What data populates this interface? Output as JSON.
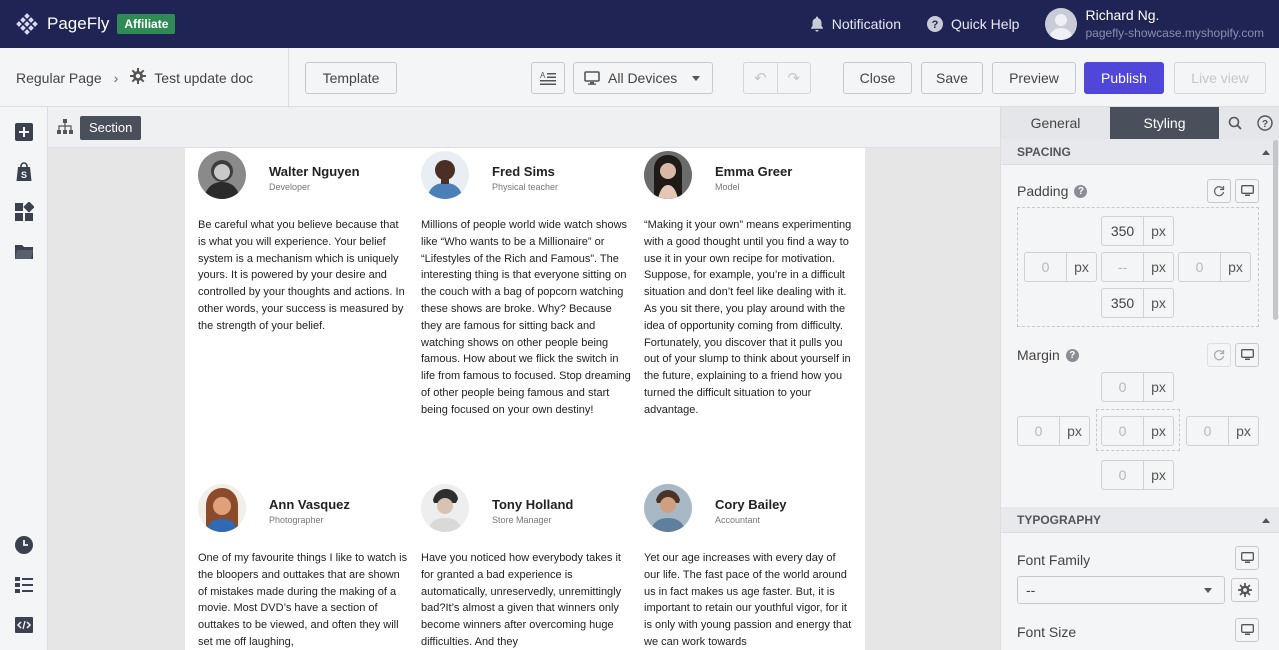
{
  "topbar": {
    "brand": "PageFly",
    "badge": "Affiliate",
    "notification": "Notification",
    "quick_help": "Quick Help",
    "user_name": "Richard Ng.",
    "user_shop": "pagefly-showcase.myshopify.com"
  },
  "toolbar": {
    "page_type": "Regular Page",
    "page_name": "Test update doc",
    "template": "Template",
    "devices": "All Devices",
    "close": "Close",
    "save": "Save",
    "preview": "Preview",
    "publish": "Publish",
    "live_view": "Live view"
  },
  "canvas": {
    "section_tag": "Section",
    "cards": [
      {
        "name": "Walter Nguyen",
        "role": "Developer",
        "quote": "Be careful what you believe because that is what you will experience. Your belief system is a mechanism which is uniquely yours. It is powered by your desire and controlled by your thoughts and actions. In other words, your success is measured by the strength of your belief."
      },
      {
        "name": "Fred Sims",
        "role": "Physical teacher",
        "quote": "Millions of people world wide watch shows like “Who wants to be a Millionaire” or “Lifestyles of the Rich and Famous”. The interesting thing is that everyone sitting on the couch with a bag of popcorn watching these shows are broke. Why? Because they are famous for sitting back and watching shows on other people being famous. How about we flick the switch in life from famous to focused. Stop dreaming of other people being famous and start being focused on your own destiny!"
      },
      {
        "name": "Emma Greer",
        "role": "Model",
        "quote": "“Making it your own” means experimenting with a good thought until you find a way to use it in your own recipe for motivation. Suppose, for example, you’re in a difficult situation and don’t feel like dealing with it. As you sit there, you play around with the idea of opportunity coming from difficulty. Fortunately, you discover that it pulls you out of your slump to think about yourself in the future, explaining to a friend how you turned the difficult situation to your advantage."
      },
      {
        "name": "Ann Vasquez",
        "role": "Photographer",
        "quote": "One of my favourite things I like to watch is the bloopers and outtakes that are shown of mistakes made during the making of a movie. Most DVD’s have a section of outtakes to be viewed, and often they will set me off laughing,"
      },
      {
        "name": "Tony Holland",
        "role": "Store Manager",
        "quote": "Have you noticed how everybody takes it for granted a bad experience is automatically, unreservedly, unremittingly bad?It’s almost a given that winners only become winners after overcoming huge difficulties. And they"
      },
      {
        "name": "Cory Bailey",
        "role": "Accountant",
        "quote": "Yet our age increases with every day of our life. The fast pace of the world around us in fact makes us age faster. But, it is important to retain our youthful vigor, for it is only with young passion and energy that we can work towards"
      }
    ]
  },
  "panel": {
    "tab_general": "General",
    "tab_styling": "Styling",
    "spacing_header": "SPACING",
    "padding_label": "Padding",
    "padding": {
      "top": "350",
      "left": "0",
      "center": "--",
      "right": "0",
      "bottom": "350",
      "unit": "px"
    },
    "margin_label": "Margin",
    "margin": {
      "top": "0",
      "left": "0",
      "center": "0",
      "right": "0",
      "bottom": "0",
      "unit": "px"
    },
    "typography_header": "TYPOGRAPHY",
    "font_family_label": "Font Family",
    "font_family_value": "--",
    "font_size_label": "Font Size",
    "help_glyph": "?"
  },
  "icons": [
    "pagefly-logo-icon",
    "bell-icon",
    "question-circle-icon",
    "gear-icon",
    "text-align-icon",
    "desktop-icon",
    "undo-icon",
    "redo-icon",
    "add-icon",
    "shopify-bag-icon",
    "blocks-icon",
    "folder-icon",
    "history-icon",
    "list-icon",
    "code-icon",
    "tree-icon",
    "search-icon",
    "refresh-icon"
  ]
}
